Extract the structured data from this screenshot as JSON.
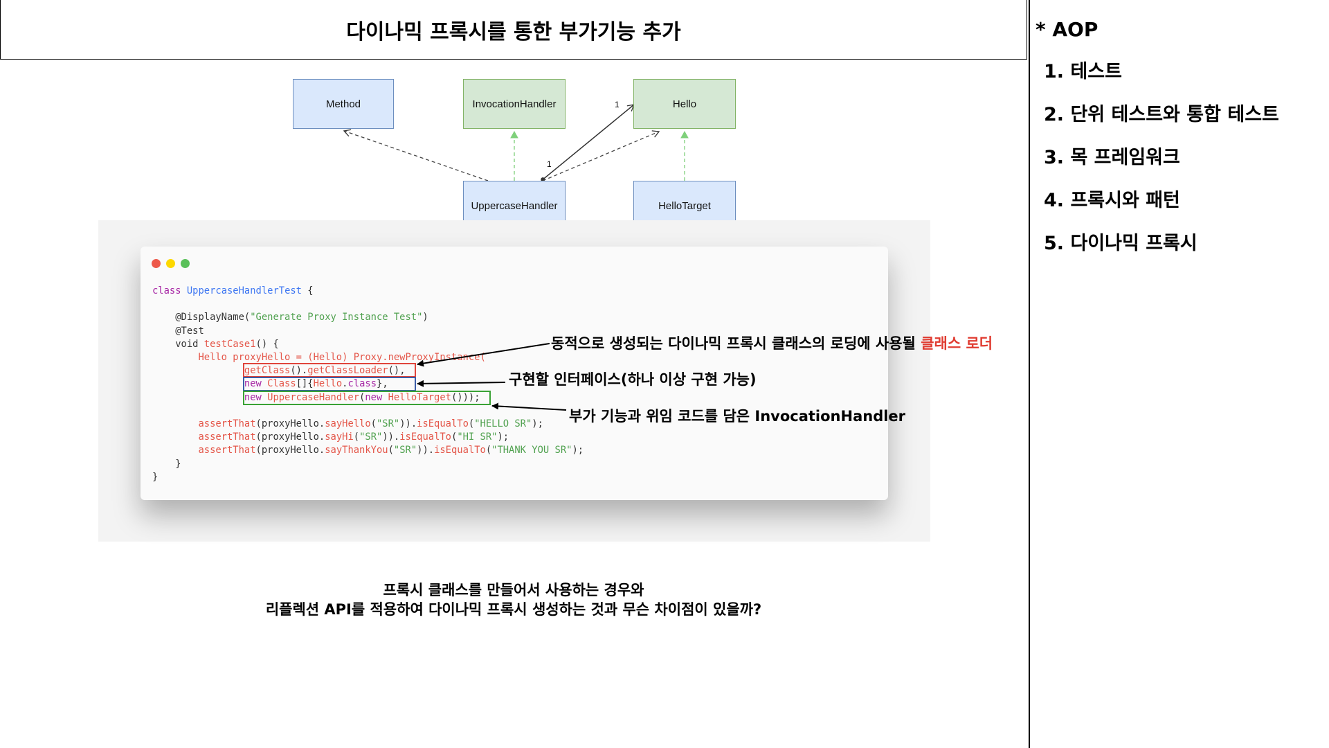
{
  "title": "다이나믹 프록시를 통한 부가기능 추가",
  "sidebar": {
    "heading": "* AOP",
    "items": [
      "1. 테스트",
      "2. 단위 테스트와 통합 테스트",
      "3. 목 프레임워크",
      "4. 프록시와 패턴",
      "5. 다이나믹 프록시"
    ]
  },
  "diagram": {
    "boxes": {
      "method": "Method",
      "invocation_handler": "InvocationHandler",
      "hello": "Hello",
      "uppercase_handler": "UppercaseHandler",
      "hello_target": "HelloTarget"
    },
    "multiplicity_top": "1",
    "multiplicity_bottom": "1"
  },
  "code": {
    "l1": {
      "kw": "class",
      "name": "UppercaseHandlerTest",
      "tail": " {"
    },
    "l3": {
      "ann": "@DisplayName(",
      "str": "\"Generate Proxy Instance Test\"",
      "tail": ")"
    },
    "l4": "@Test",
    "l5": {
      "kw": "void",
      "name": "testCase1",
      "tail": "() {"
    },
    "l6": "Hello proxyHello = (Hello) Proxy.newProxyInstance(",
    "l7": {
      "a": "getClass",
      "b": "().",
      "c": "getClassLoader",
      "d": "(),"
    },
    "l8": {
      "kw": "new",
      "cls": "Class",
      "b": "[]{",
      "c": "Hello",
      "d": ".",
      "e": "class",
      "f": "},"
    },
    "l9": {
      "kw": "new",
      "cls": "UppercaseHandler",
      "b": "(",
      "kw2": "new",
      "c": "HelloTarget",
      "d": "()));"
    },
    "a1": {
      "a": "assertThat",
      "b": "(proxyHello.",
      "c": "sayHello",
      "d": "(",
      "s": "\"SR\"",
      "e": ")).",
      "f": "isEqualTo",
      "g": "(",
      "t": "\"HELLO SR\"",
      "h": ");"
    },
    "a2": {
      "a": "assertThat",
      "b": "(proxyHello.",
      "c": "sayHi",
      "d": "(",
      "s": "\"SR\"",
      "e": ")).",
      "f": "isEqualTo",
      "g": "(",
      "t": "\"HI SR\"",
      "h": ");"
    },
    "a3": {
      "a": "assertThat",
      "b": "(proxyHello.",
      "c": "sayThankYou",
      "d": "(",
      "s": "\"SR\"",
      "e": ")).",
      "f": "isEqualTo",
      "g": "(",
      "t": "\"THANK YOU SR\"",
      "h": ");"
    },
    "close_inner": "}",
    "close_outer": "}"
  },
  "annotations": {
    "class_loader": {
      "text": "동적으로 생성되는 다이나믹 프록시 클래스의 로딩에 사용될 ",
      "highlight": "클래스 로더"
    },
    "interfaces": "구현할 인터페이스(하나 이상 구현 가능)",
    "handler": "부가 기능과 위임 코드를 담은 InvocationHandler"
  },
  "question": {
    "line1": "프록시 클래스를 만들어서 사용하는 경우와",
    "line2": "리플렉션 API를 적용하여 다이나믹 프록시 생성하는 것과 무슨 차이점이 있을까?"
  },
  "colors": {
    "highlight_red": "#e03c31",
    "box_red": "#e0443b",
    "box_blue": "#3b5ea8",
    "box_green": "#3aa235"
  }
}
